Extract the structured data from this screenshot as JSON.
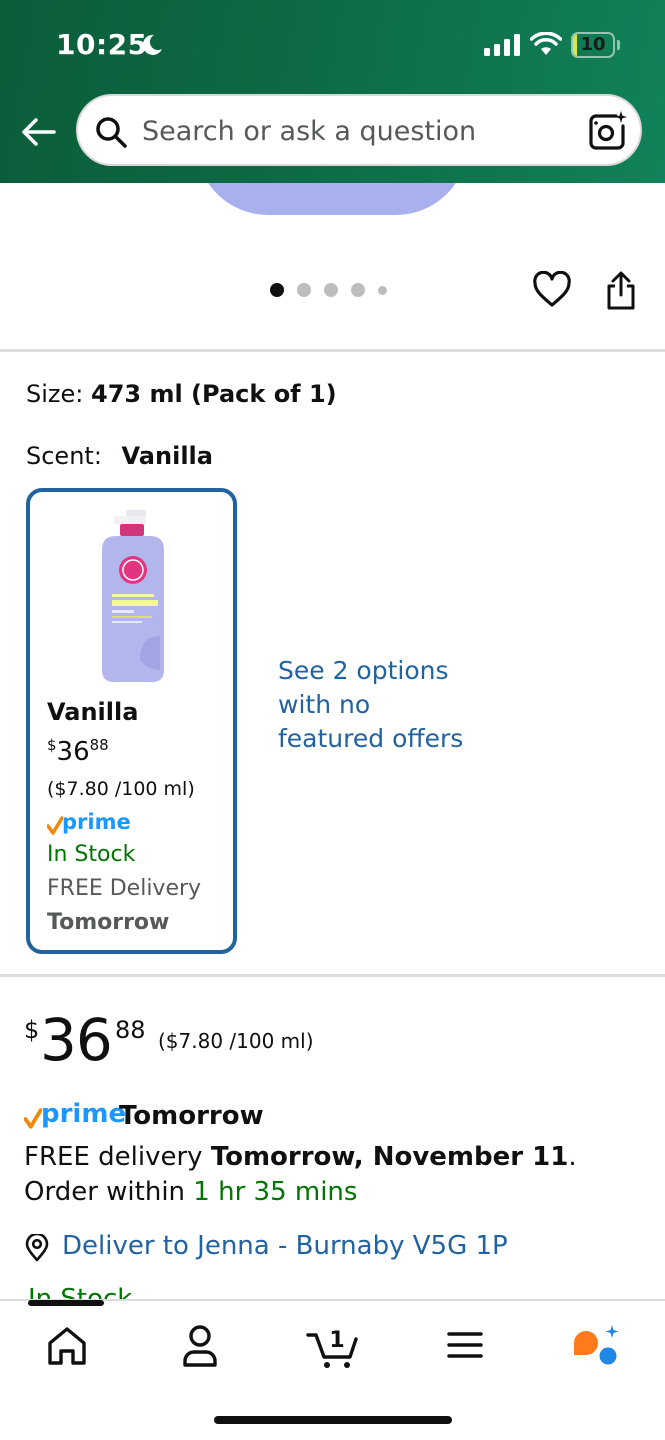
{
  "status_bar": {
    "time": "10:25",
    "battery_level": "10",
    "battery_fraction": 0.1
  },
  "search": {
    "placeholder": "Search or ask a question"
  },
  "gallery": {
    "dot_count": 5,
    "active_index": 0
  },
  "variations": {
    "size_label": "Size:",
    "size_value": "473 ml (Pack of 1)",
    "scent_label": "Scent:",
    "scent_value": "Vanilla"
  },
  "variant_card": {
    "name": "Vanilla",
    "price_currency": "$",
    "price_whole": "36",
    "price_cents": "88",
    "unit_price": "($7.80 /100 ml)",
    "prime_label": "prime",
    "stock": "In Stock",
    "delivery": "FREE Delivery",
    "delivery_day": "Tomorrow"
  },
  "see_options": {
    "text": "See 2 options with no featured offers"
  },
  "buy_box": {
    "price_currency": "$",
    "price_whole": "36",
    "price_cents": "88",
    "unit_price": "($7.80 /100 ml)",
    "prime_label": "prime",
    "prime_day": "Tomorrow",
    "delivery_prefix": "FREE delivery ",
    "delivery_date": "Tomorrow, November 11",
    "delivery_suffix": ". Order within ",
    "order_within": "1 hr 35 mins",
    "deliver_to": "Deliver to Jenna - Burnaby V5G 1P",
    "stock_peek": "In Stock"
  },
  "bottom_nav": {
    "items": [
      "home",
      "account",
      "cart",
      "menu",
      "rufus"
    ],
    "cart_count": "1"
  },
  "colors": {
    "header_start": "#0b5d3a",
    "header_end": "#118259",
    "link": "#2162a1",
    "stock_green": "#007600",
    "prime_blue": "#1a98ff",
    "prime_check": "#f08804"
  }
}
